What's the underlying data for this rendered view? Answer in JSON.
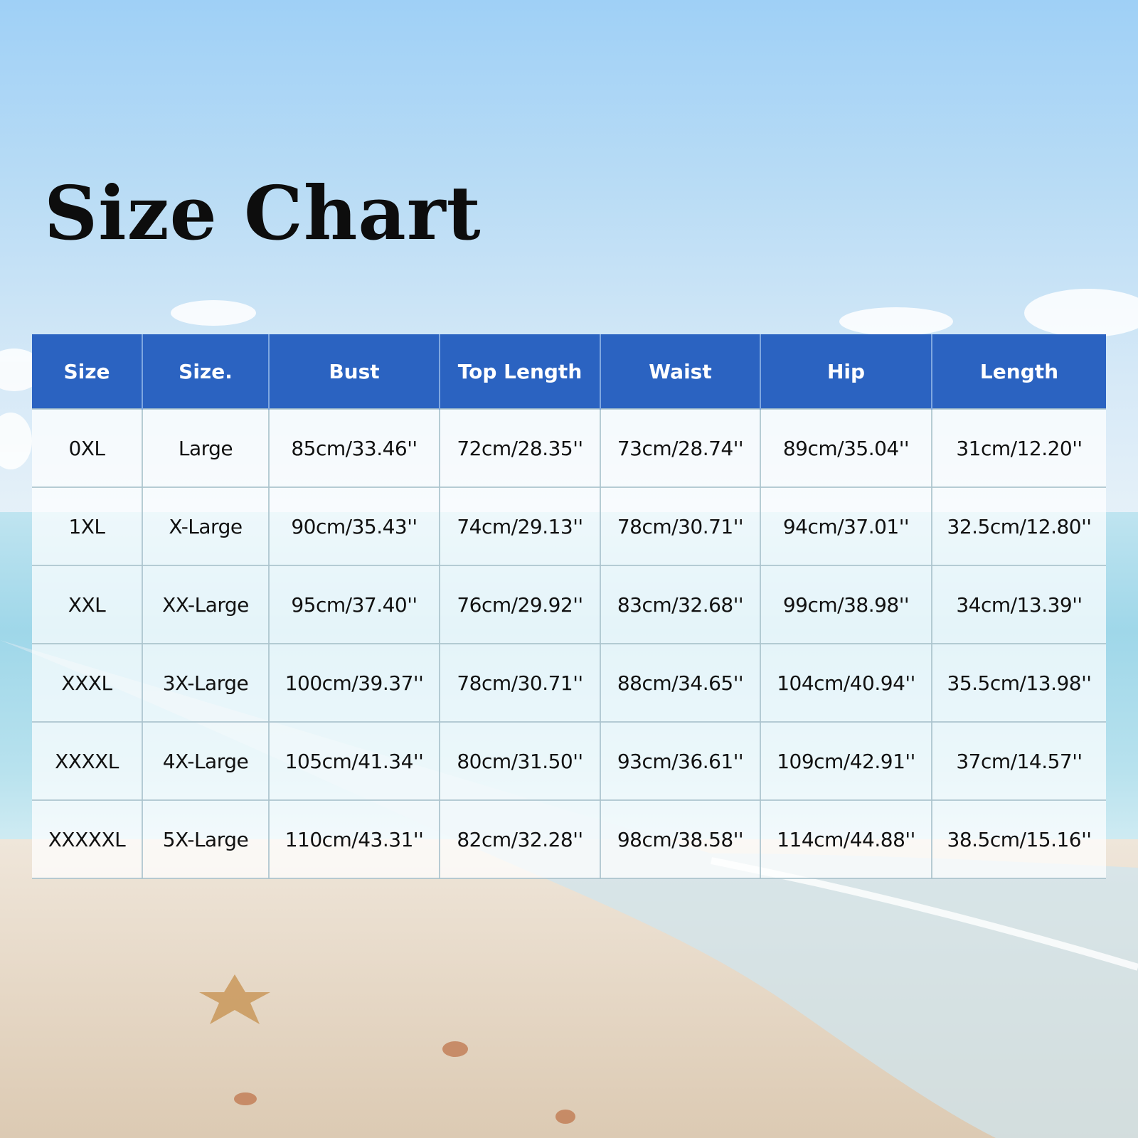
{
  "title": "Size Chart",
  "colors": {
    "header_bg": "#2b63c1",
    "header_text": "#ffffff",
    "cell_text": "#111111",
    "title_text": "#0d0d0d"
  },
  "chart_data": {
    "type": "table",
    "title": "Size Chart",
    "columns": [
      "Size",
      "Size.",
      "Bust",
      "Top Length",
      "Waist",
      "Hip",
      "Length"
    ],
    "rows": [
      [
        "0XL",
        "Large",
        "85cm/33.46''",
        "72cm/28.35''",
        "73cm/28.74''",
        "89cm/35.04''",
        "31cm/12.20''"
      ],
      [
        "1XL",
        "X-Large",
        "90cm/35.43''",
        "74cm/29.13''",
        "78cm/30.71''",
        "94cm/37.01''",
        "32.5cm/12.80''"
      ],
      [
        "XXL",
        "XX-Large",
        "95cm/37.40''",
        "76cm/29.92''",
        "83cm/32.68''",
        "99cm/38.98''",
        "34cm/13.39''"
      ],
      [
        "XXXL",
        "3X-Large",
        "100cm/39.37''",
        "78cm/30.71''",
        "88cm/34.65''",
        "104cm/40.94''",
        "35.5cm/13.98''"
      ],
      [
        "XXXXL",
        "4X-Large",
        "105cm/41.34''",
        "80cm/31.50''",
        "93cm/36.61''",
        "109cm/42.91''",
        "37cm/14.57''"
      ],
      [
        "XXXXXL",
        "5X-Large",
        "110cm/43.31''",
        "82cm/32.28''",
        "98cm/38.58''",
        "114cm/44.88''",
        "38.5cm/15.16''"
      ]
    ]
  }
}
